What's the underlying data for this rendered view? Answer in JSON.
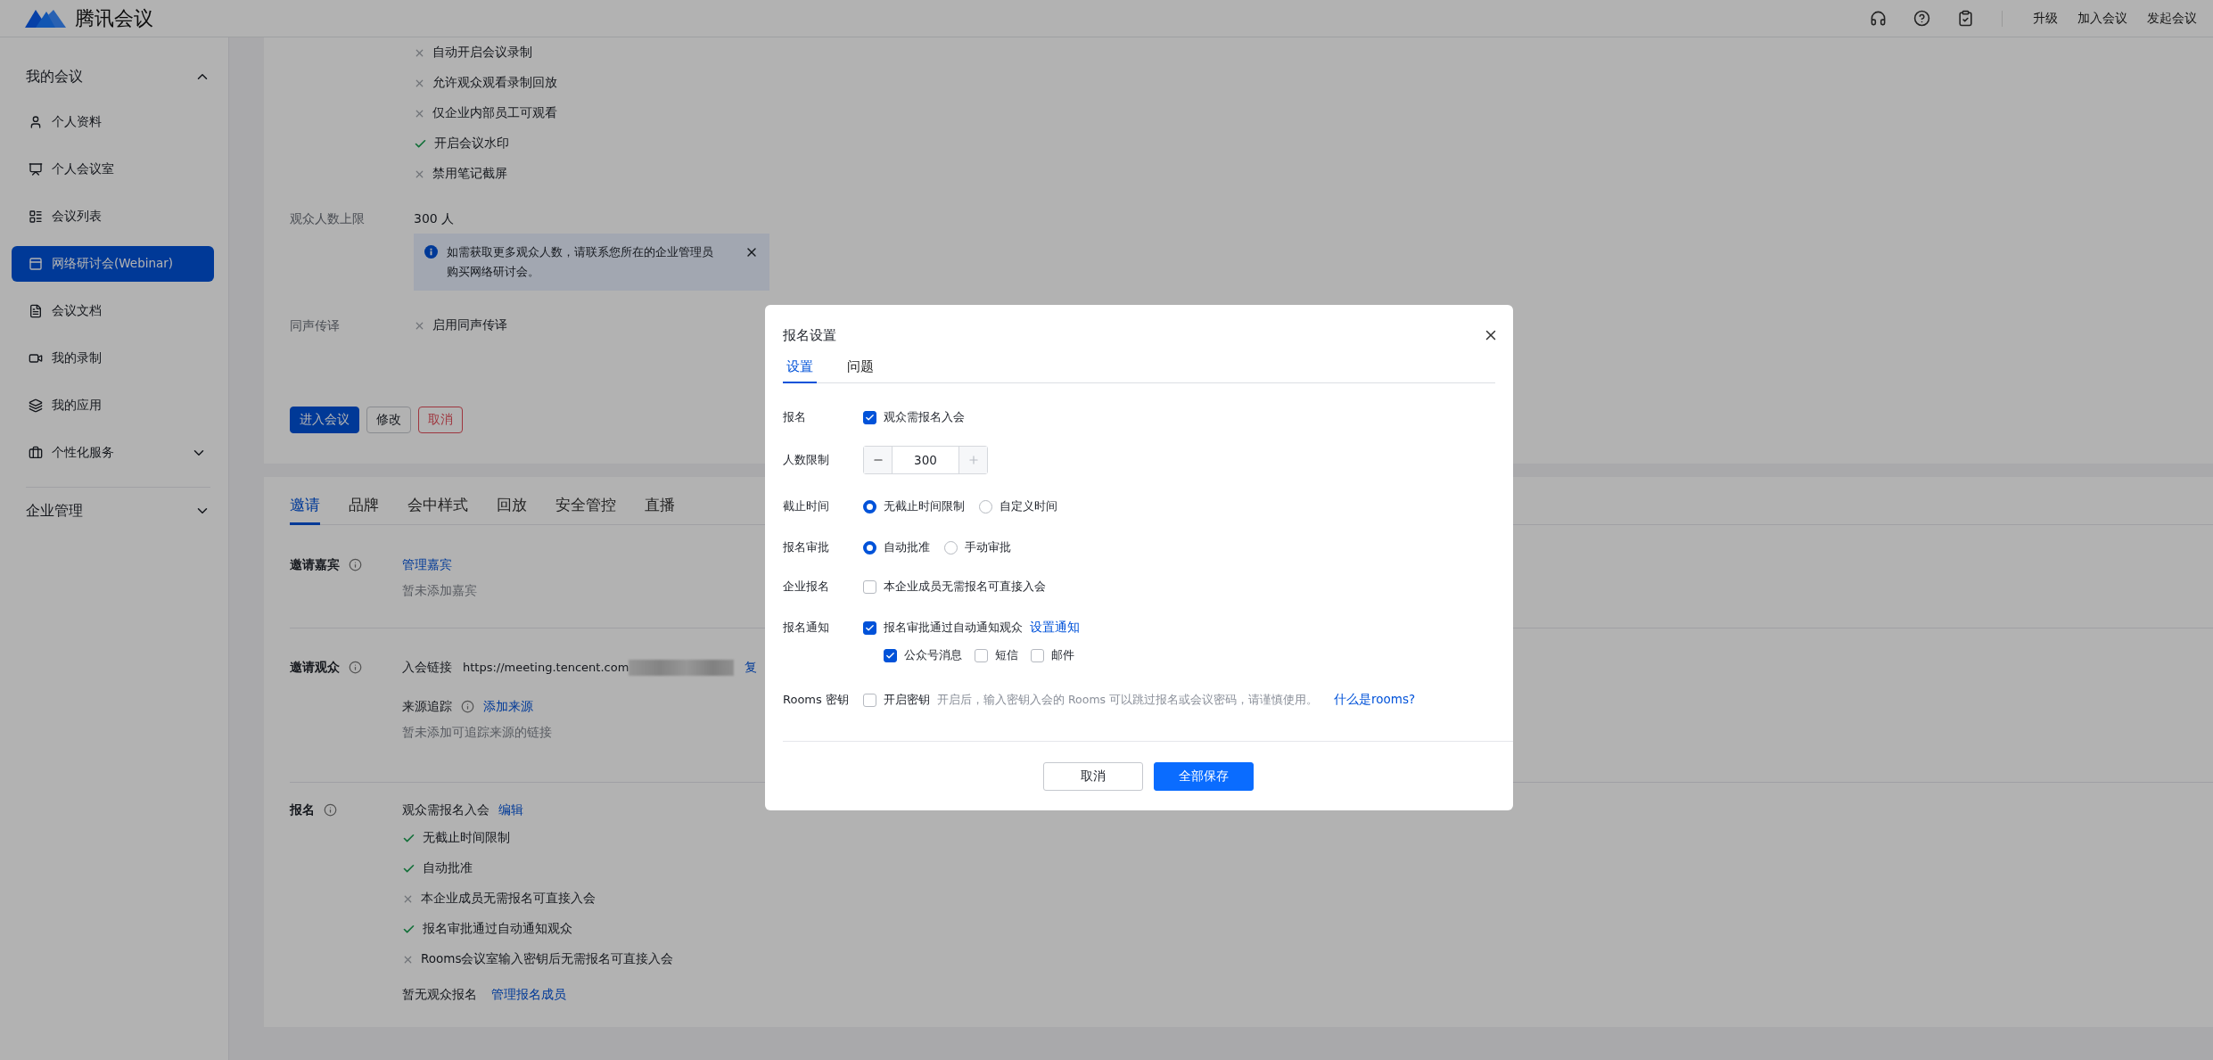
{
  "header": {
    "logo": "腾讯会议",
    "links": [
      "升级",
      "加入会议",
      "发起会议"
    ]
  },
  "sidebar": {
    "groups": [
      {
        "label": "我的会议",
        "expanded": true,
        "items": [
          {
            "label": "个人资料",
            "kind": "page",
            "selected": false
          },
          {
            "label": "个人会议室",
            "kind": "page",
            "selected": false
          },
          {
            "label": "会议列表",
            "kind": "page",
            "selected": false
          },
          {
            "label": "网络研讨会(Webinar)",
            "kind": "page",
            "selected": true
          },
          {
            "label": "会议文档",
            "kind": "page",
            "selected": false
          },
          {
            "label": "我的录制",
            "kind": "page",
            "selected": false
          },
          {
            "label": "我的应用",
            "kind": "page",
            "selected": false
          },
          {
            "label": "个性化服务",
            "kind": "submenu",
            "selected": false,
            "expanded": false
          }
        ]
      },
      {
        "label": "企业管理",
        "expanded": false
      }
    ]
  },
  "meeting": {
    "options": [
      {
        "label": "自动开启会议录制",
        "on": false
      },
      {
        "label": "允许观众观看录制回放",
        "on": false
      },
      {
        "label": "仅企业内部员工可观看",
        "on": false
      },
      {
        "label": "开启会议水印",
        "on": true
      },
      {
        "label": "禁用笔记截屏",
        "on": false
      }
    ],
    "limit": {
      "label": "观众人数上限",
      "value": "300 人",
      "notice": "如需获取更多观众人数，请联系您所在的企业管理员购买网络研讨会。"
    },
    "interpretation": {
      "label": "同声传译",
      "options": [
        {
          "label": "启用同声传译",
          "on": false
        }
      ]
    },
    "actions": [
      {
        "label": "进入会议",
        "kind": "primary"
      },
      {
        "label": "修改",
        "kind": "default"
      },
      {
        "label": "取消",
        "kind": "danger"
      }
    ]
  },
  "details": {
    "tabs": [
      {
        "label": "邀请",
        "selected": true
      },
      {
        "label": "品牌",
        "selected": false
      },
      {
        "label": "会中样式",
        "selected": false
      },
      {
        "label": "回放",
        "selected": false
      },
      {
        "label": "安全管控",
        "selected": false
      },
      {
        "label": "直播",
        "selected": false
      }
    ],
    "guests": {
      "label": "邀请嘉宾",
      "link": "管理嘉宾",
      "note": "暂未添加嘉宾"
    },
    "audience": {
      "label": "邀请观众",
      "link_label": "入会链接",
      "url": "https://meeting.tencent.com",
      "copy": "复",
      "source_label": "来源追踪",
      "source_link": "添加来源",
      "note": "暂未添加可追踪来源的链接"
    },
    "registration": {
      "label": "报名",
      "summary": "观众需报名入会",
      "edit": "编辑",
      "options": [
        {
          "label": "无截止时间限制",
          "on": true
        },
        {
          "label": "自动批准",
          "on": true
        },
        {
          "label": "本企业成员无需报名可直接入会",
          "on": false
        },
        {
          "label": "报名审批通过自动通知观众",
          "on": true
        },
        {
          "label": "Rooms会议室输入密钥后无需报名可直接入会",
          "on": false
        }
      ],
      "footer": "暂无观众报名",
      "footer_link": "管理报名成员"
    }
  },
  "dialog": {
    "title": "报名设置",
    "tabs": [
      {
        "label": "设置",
        "selected": true
      },
      {
        "label": "问题",
        "selected": false
      }
    ],
    "rows": [
      {
        "label": "报名",
        "kind": "checkbox",
        "options": [
          {
            "label": "观众需报名入会",
            "checked": true
          }
        ]
      },
      {
        "label": "人数限制",
        "kind": "stepper",
        "value": "300",
        "increase_disabled": true
      },
      {
        "label": "截止时间",
        "kind": "radio",
        "options": [
          {
            "label": "无截止时间限制",
            "selected": true
          },
          {
            "label": "自定义时间",
            "selected": false
          }
        ]
      },
      {
        "label": "报名审批",
        "kind": "radio",
        "options": [
          {
            "label": "自动批准",
            "selected": true
          },
          {
            "label": "手动审批",
            "selected": false
          }
        ]
      },
      {
        "label": "企业报名",
        "kind": "checkbox",
        "options": [
          {
            "label": "本企业成员无需报名可直接入会",
            "checked": false
          }
        ]
      },
      {
        "label": "报名通知",
        "kind": "checkbox",
        "options": [
          {
            "label": "报名审批通过自动通知观众",
            "checked": true
          }
        ],
        "link": "设置通知",
        "sub_options": [
          {
            "label": "公众号消息",
            "checked": true
          },
          {
            "label": "短信",
            "checked": false
          },
          {
            "label": "邮件",
            "checked": false
          }
        ]
      },
      {
        "label": "Rooms 密钥",
        "kind": "checkbox",
        "options": [
          {
            "label": "开启密钥",
            "checked": false
          }
        ],
        "hint": "开启后，输入密钥入会的 Rooms 可以跳过报名或会议密码，请谨慎使用。",
        "link": "什么是rooms?"
      }
    ],
    "buttons": [
      {
        "label": "取消",
        "kind": "default"
      },
      {
        "label": "全部保存",
        "kind": "primary"
      }
    ]
  }
}
